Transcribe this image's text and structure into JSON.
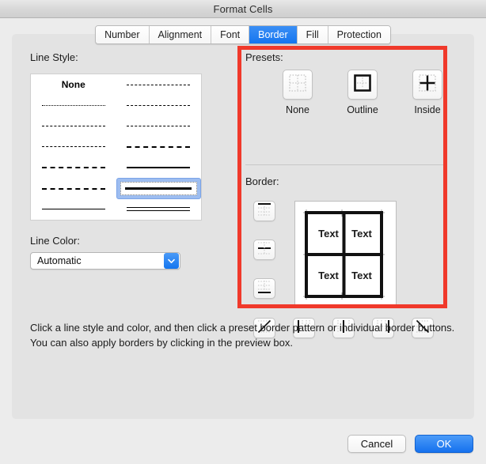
{
  "window": {
    "title": "Format Cells"
  },
  "tabs": [
    {
      "label": "Number",
      "active": false
    },
    {
      "label": "Alignment",
      "active": false
    },
    {
      "label": "Font",
      "active": false
    },
    {
      "label": "Border",
      "active": true
    },
    {
      "label": "Fill",
      "active": false
    },
    {
      "label": "Protection",
      "active": false
    }
  ],
  "line_style": {
    "label": "Line Style:",
    "none_label": "None",
    "options": [
      {
        "name": "none",
        "style": "l-blank",
        "selected": false
      },
      {
        "name": "dash-dot-dot-thin",
        "style": "l-dashdot",
        "selected": false
      },
      {
        "name": "dotted",
        "style": "l-dot",
        "selected": false
      },
      {
        "name": "dash-dot-dot-medium",
        "style": "l-dashdot2",
        "selected": false
      },
      {
        "name": "dashed-fine",
        "style": "l-dash-sm",
        "selected": false
      },
      {
        "name": "dash-dot-medium",
        "style": "l-dashdot-r",
        "selected": false
      },
      {
        "name": "dash-dot-thin",
        "style": "l-dashdot",
        "selected": false
      },
      {
        "name": "dashed-medium",
        "style": "l-dash-lg",
        "selected": false
      },
      {
        "name": "dash-dot-long",
        "style": "l-dashdot-b",
        "selected": false
      },
      {
        "name": "solid-medium",
        "style": "l-medium",
        "selected": false
      },
      {
        "name": "dashed-tight",
        "style": "l-dash-hv",
        "selected": false
      },
      {
        "name": "solid-thick",
        "style": "l-thick",
        "selected": true
      },
      {
        "name": "solid-thin",
        "style": "l-thin",
        "selected": false
      },
      {
        "name": "double",
        "style": "l-double",
        "selected": false
      }
    ]
  },
  "line_color": {
    "label": "Line Color:",
    "value": "Automatic",
    "dropdown_icon": "chevron-down-icon",
    "accent": "#1476ef"
  },
  "presets": {
    "label": "Presets:",
    "items": [
      {
        "label": "None",
        "icon": "preset-none-icon"
      },
      {
        "label": "Outline",
        "icon": "preset-outline-icon"
      },
      {
        "label": "Inside",
        "icon": "preset-inside-icon"
      }
    ]
  },
  "border": {
    "label": "Border:",
    "preview_cell_text": "Text",
    "preview_cells": [
      "Text",
      "Text",
      "Text",
      "Text"
    ],
    "side_buttons": [
      {
        "name": "border-top-button",
        "icon": "border-top-icon"
      },
      {
        "name": "border-horizontal-inner-button",
        "icon": "border-horizontal-inner-icon"
      },
      {
        "name": "border-bottom-button",
        "icon": "border-bottom-icon"
      }
    ],
    "bottom_buttons": [
      {
        "name": "border-diagonal-up-button",
        "icon": "border-diagonal-up-icon"
      },
      {
        "name": "border-left-button",
        "icon": "border-left-icon"
      },
      {
        "name": "border-vertical-inner-button",
        "icon": "border-vertical-inner-icon"
      },
      {
        "name": "border-right-button",
        "icon": "border-right-icon"
      },
      {
        "name": "border-diagonal-down-button",
        "icon": "border-diagonal-down-icon"
      }
    ]
  },
  "description": "Click a line style and color, and then click a preset border pattern or individual border buttons. You can also apply borders by clicking in the preview box.",
  "footer": {
    "cancel_label": "Cancel",
    "ok_label": "OK"
  },
  "annotation": {
    "type": "rectangle-highlight",
    "color": "#f0392b"
  }
}
